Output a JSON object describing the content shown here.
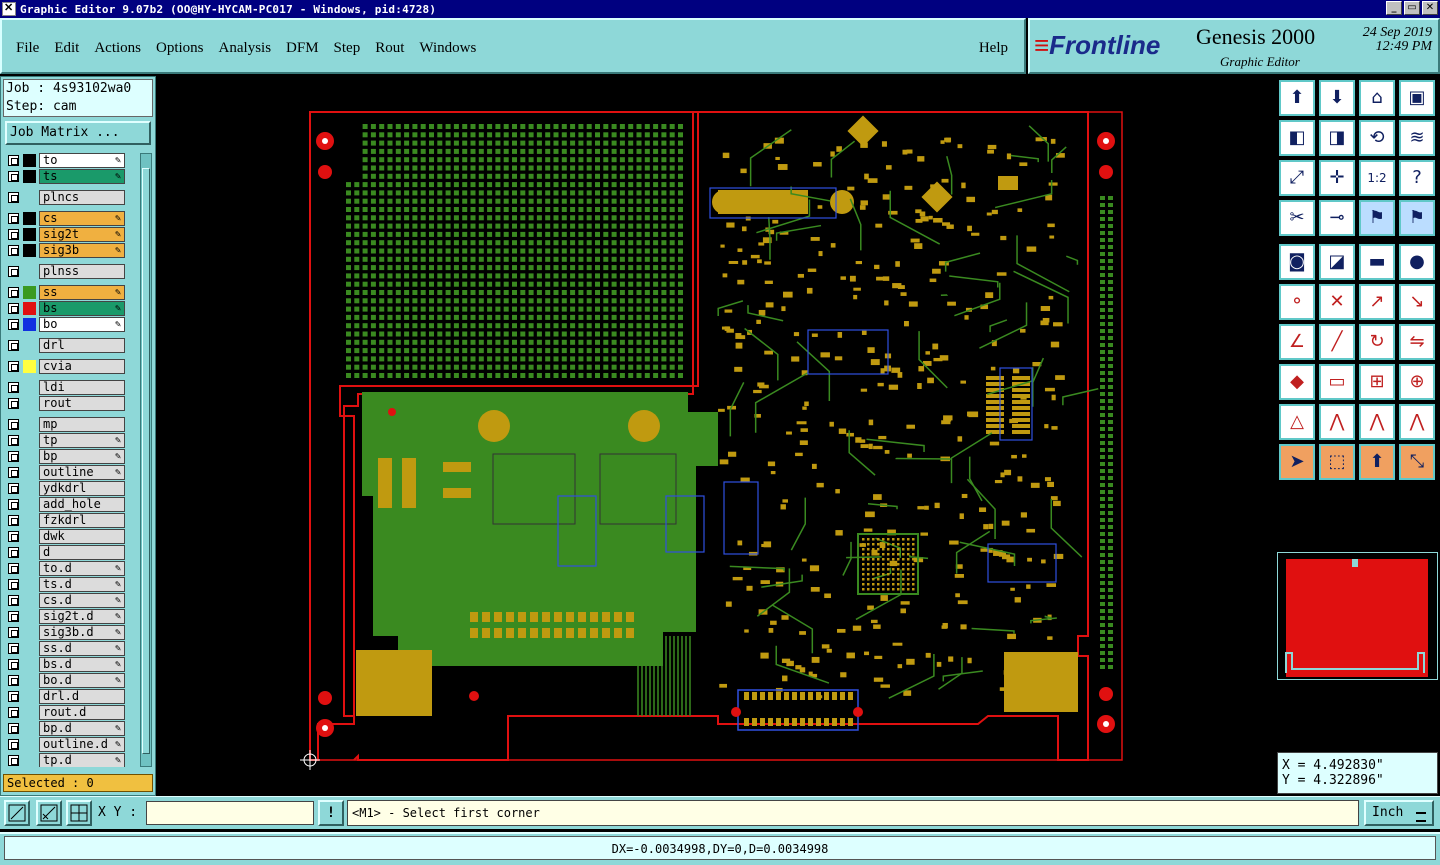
{
  "window": {
    "title": "Graphic Editor 9.07b2 (OO@HY-HYCAM-PC017 - Windows, pid:4728)",
    "buttons": [
      "minimize",
      "restore",
      "close"
    ]
  },
  "menu": {
    "items": [
      "File",
      "Edit",
      "Actions",
      "Options",
      "Analysis",
      "DFM",
      "Step",
      "Rout",
      "Windows"
    ],
    "help": "Help"
  },
  "brand": {
    "logo": "Frontline",
    "product": "Genesis 2000",
    "subtitle": "Graphic Editor",
    "date": "24 Sep 2019",
    "time": "12:49 PM"
  },
  "job": {
    "job_line": "Job : 4s93102wa0",
    "step_line": "Step: cam",
    "matrix_button": "Job Matrix ..."
  },
  "layers": [
    {
      "name": "to",
      "color": "#ffffff",
      "swatch": "#000000",
      "edit": true
    },
    {
      "name": "ts",
      "color": "#1a9a6a",
      "swatch": "#000000",
      "edit": true
    },
    {
      "name": "plncs",
      "color": "#dcdcdc",
      "swatch": null,
      "edit": false
    },
    {
      "name": "cs",
      "color": "#f0b040",
      "swatch": "#000000",
      "edit": true
    },
    {
      "name": "sig2t",
      "color": "#f0b040",
      "swatch": "#000000",
      "edit": true
    },
    {
      "name": "sig3b",
      "color": "#f0b040",
      "swatch": "#000000",
      "edit": true
    },
    {
      "name": "plnss",
      "color": "#dcdcdc",
      "swatch": null,
      "edit": false
    },
    {
      "name": "ss",
      "color": "#f0b040",
      "swatch": "#3a9a20",
      "edit": true
    },
    {
      "name": "bs",
      "color": "#1a9a6a",
      "swatch": "#e01010",
      "edit": true
    },
    {
      "name": "bo",
      "color": "#ffffff",
      "swatch": "#1030e0",
      "edit": true
    },
    {
      "name": "drl",
      "color": "#dcdcdc",
      "swatch": null,
      "edit": false
    },
    {
      "name": "cvia",
      "color": "#dcdcdc",
      "swatch": "#ffff40",
      "edit": false
    },
    {
      "name": "ldi",
      "color": "#dcdcdc",
      "swatch": null,
      "edit": false
    },
    {
      "name": "rout",
      "color": "#dcdcdc",
      "swatch": null,
      "edit": false
    },
    {
      "name": "mp",
      "color": "#dcdcdc",
      "swatch": null,
      "edit": false
    },
    {
      "name": "tp",
      "color": "#dcdcdc",
      "swatch": null,
      "edit": true
    },
    {
      "name": "bp",
      "color": "#dcdcdc",
      "swatch": null,
      "edit": true
    },
    {
      "name": "outline",
      "color": "#dcdcdc",
      "swatch": null,
      "edit": true
    },
    {
      "name": "ydkdrl",
      "color": "#dcdcdc",
      "swatch": null,
      "edit": false
    },
    {
      "name": "add_hole",
      "color": "#dcdcdc",
      "swatch": null,
      "edit": false
    },
    {
      "name": "fzkdrl",
      "color": "#dcdcdc",
      "swatch": null,
      "edit": false
    },
    {
      "name": "dwk",
      "color": "#dcdcdc",
      "swatch": null,
      "edit": false
    },
    {
      "name": "d",
      "color": "#dcdcdc",
      "swatch": null,
      "edit": false
    },
    {
      "name": "to.d",
      "color": "#dcdcdc",
      "swatch": null,
      "edit": true
    },
    {
      "name": "ts.d",
      "color": "#dcdcdc",
      "swatch": null,
      "edit": true
    },
    {
      "name": "cs.d",
      "color": "#dcdcdc",
      "swatch": null,
      "edit": true
    },
    {
      "name": "sig2t.d",
      "color": "#dcdcdc",
      "swatch": null,
      "edit": true
    },
    {
      "name": "sig3b.d",
      "color": "#dcdcdc",
      "swatch": null,
      "edit": true
    },
    {
      "name": "ss.d",
      "color": "#dcdcdc",
      "swatch": null,
      "edit": true
    },
    {
      "name": "bs.d",
      "color": "#dcdcdc",
      "swatch": null,
      "edit": true
    },
    {
      "name": "bo.d",
      "color": "#dcdcdc",
      "swatch": null,
      "edit": true
    },
    {
      "name": "drl.d",
      "color": "#dcdcdc",
      "swatch": null,
      "edit": false
    },
    {
      "name": "rout.d",
      "color": "#dcdcdc",
      "swatch": null,
      "edit": false
    },
    {
      "name": "bp.d",
      "color": "#dcdcdc",
      "swatch": null,
      "edit": true
    },
    {
      "name": "outline.d",
      "color": "#dcdcdc",
      "swatch": null,
      "edit": true
    },
    {
      "name": "tp.d",
      "color": "#dcdcdc",
      "swatch": null,
      "edit": true
    }
  ],
  "selected": "Selected : 0",
  "coords": {
    "x": "X = 4.492830\"",
    "y": "Y = 4.322896\""
  },
  "status": {
    "xy_label": "X Y :",
    "xy_value": "",
    "prompt": "<M1> - Select first corner",
    "units": "Inch",
    "measure": "DX=-0.0034998,DY=0,D=0.0034998"
  },
  "tools": [
    "layer-up-icon",
    "layer-down-icon",
    "home-icon",
    "window-icon",
    "pan-left-icon",
    "pan-right-icon",
    "swap-icon",
    "split-icon",
    "zoom-fit-icon",
    "zoom-center-icon",
    "one-to-two-icon",
    "help-icon",
    "measure-icon",
    "snap-icon",
    "flip-icon",
    "flip-alt-icon",
    "pad-icon",
    "edit-shape-icon",
    "ruler-icon",
    "dot-icon",
    "connect-icon",
    "cross-icon",
    "vector-icon",
    "vector-alt-icon",
    "angle-icon",
    "line-icon",
    "arc-icon",
    "mirror-icon",
    "pad-add-icon",
    "segment-icon",
    "scale-icon",
    "group-icon",
    "triangle-icon",
    "triangle-alt-icon",
    "triangle-red-icon",
    "triangle-cut-icon",
    "select-icon",
    "select-box-icon",
    "select-touch-icon",
    "select-net-icon"
  ]
}
